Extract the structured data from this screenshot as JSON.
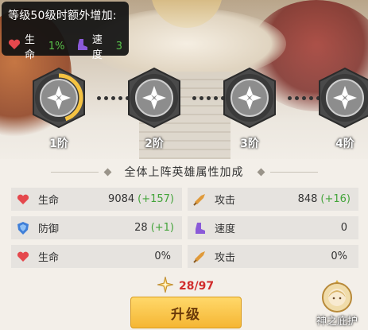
{
  "tooltip": {
    "title": "等级50级时额外增加:",
    "stat1_label": "生命",
    "stat1_value": "1%",
    "stat2_label": "速度",
    "stat2_value": "3"
  },
  "stages": [
    {
      "label": "1阶",
      "progress": 0.45
    },
    {
      "label": "2阶",
      "progress": 0
    },
    {
      "label": "3阶",
      "progress": 0
    },
    {
      "label": "4阶",
      "progress": 0
    }
  ],
  "section_title": "全体上阵英雄属性加成",
  "stats": [
    {
      "icon": "heart-icon",
      "label": "生命",
      "value": "9084",
      "bonus": "(+157)"
    },
    {
      "icon": "sword-icon",
      "label": "攻击",
      "value": "848",
      "bonus": "(+16)"
    },
    {
      "icon": "shield-icon",
      "label": "防御",
      "value": "28",
      "bonus": "(+1)"
    },
    {
      "icon": "boot-icon",
      "label": "速度",
      "value": "0",
      "bonus": ""
    },
    {
      "icon": "heart-icon",
      "label": "生命",
      "value": "0%",
      "bonus": ""
    },
    {
      "icon": "sword-icon",
      "label": "攻击",
      "value": "0%",
      "bonus": ""
    }
  ],
  "cost": {
    "value": "28/97"
  },
  "upgrade_button": {
    "label": "升级"
  },
  "shelter": {
    "label": "神之庇护"
  },
  "colors": {
    "accent_yellow": "#f5c342",
    "bonus_green": "#43a43a",
    "cost_red": "#d12b2b"
  }
}
